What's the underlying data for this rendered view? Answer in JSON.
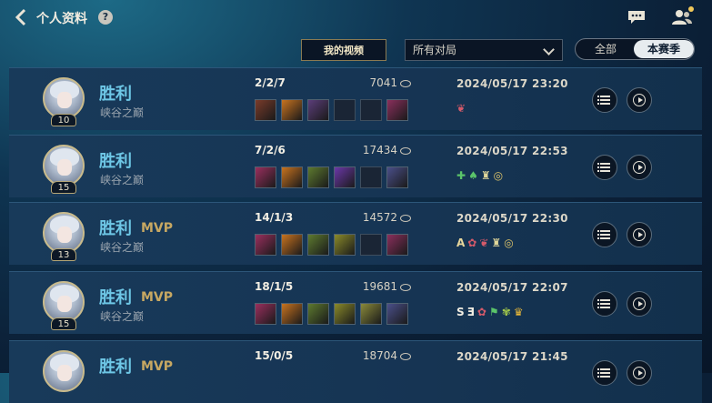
{
  "header": {
    "back_icon": "chevron-left-icon",
    "title": "个人资料",
    "help_label": "?",
    "chat_icon": "chat-bubble-icon",
    "friends_icon": "friends-icon"
  },
  "filters": {
    "my_video_label": "我的视频",
    "match_filter_value": "所有对局",
    "season_toggle": {
      "all_label": "全部",
      "season_label": "本赛季",
      "selected": "本赛季"
    }
  },
  "matches": [
    {
      "level": "10",
      "result": "胜利",
      "mvp": "",
      "mode": "峡谷之巅",
      "kda": "2/2/7",
      "gold": "7041",
      "time": "2024/05/17 23:20",
      "items": [
        "#7a3b2a",
        "#c8731f",
        "#5b3d7a",
        "",
        "",
        "#8a2f5c"
      ],
      "badges": [
        {
          "text": "❦",
          "color": "#d45a6a"
        }
      ]
    },
    {
      "level": "15",
      "result": "胜利",
      "mvp": "",
      "mode": "峡谷之巅",
      "kda": "7/2/6",
      "gold": "17434",
      "time": "2024/05/17 22:53",
      "items": [
        "#9a2f5e",
        "#c8731f",
        "#5d7a2f",
        "#6b38a8",
        "",
        "#4a4f8a"
      ],
      "badges": [
        {
          "text": "✚",
          "color": "#5bc46a"
        },
        {
          "text": "♠",
          "color": "#5bc46a"
        },
        {
          "text": "♜",
          "color": "#e0d79a"
        },
        {
          "text": "◎",
          "color": "#e0c66a"
        }
      ]
    },
    {
      "level": "13",
      "result": "胜利",
      "mvp": "MVP",
      "mode": "峡谷之巅",
      "kda": "14/1/3",
      "gold": "14572",
      "time": "2024/05/17 22:30",
      "items": [
        "#9a2f5e",
        "#c8731f",
        "#5d7a2f",
        "#8a8a2a",
        "",
        "#8a2f5c"
      ],
      "badges": [
        {
          "text": "A",
          "color": "#e8d79c"
        },
        {
          "text": "✿",
          "color": "#d45a6a"
        },
        {
          "text": "❦",
          "color": "#d45a6a"
        },
        {
          "text": "♜",
          "color": "#e0d79a"
        },
        {
          "text": "◎",
          "color": "#e0c66a"
        }
      ]
    },
    {
      "level": "15",
      "result": "胜利",
      "mvp": "MVP",
      "mode": "峡谷之巅",
      "kda": "18/1/5",
      "gold": "19681",
      "time": "2024/05/17 22:07",
      "items": [
        "#9a2f5e",
        "#c8731f",
        "#5d7a2f",
        "#8a8a2a",
        "#8a8a3a",
        "#4a4f8a"
      ],
      "badges": [
        {
          "text": "S",
          "color": "#f1ede2"
        },
        {
          "text": "Ǝ",
          "color": "#f1ede2"
        },
        {
          "text": "✿",
          "color": "#d45a6a"
        },
        {
          "text": "⚑",
          "color": "#5bc46a"
        },
        {
          "text": "✾",
          "color": "#a3c94a"
        },
        {
          "text": "♛",
          "color": "#e8b838"
        }
      ]
    },
    {
      "level": "",
      "result": "胜利",
      "mvp": "MVP",
      "mode": "",
      "kda": "15/0/5",
      "gold": "18704",
      "time": "2024/05/17 21:45",
      "items": [],
      "badges": []
    }
  ],
  "colors": {
    "win": "#6ec7e6",
    "mvp": "#c7a862",
    "accent_gold": "#c9bb8c"
  }
}
